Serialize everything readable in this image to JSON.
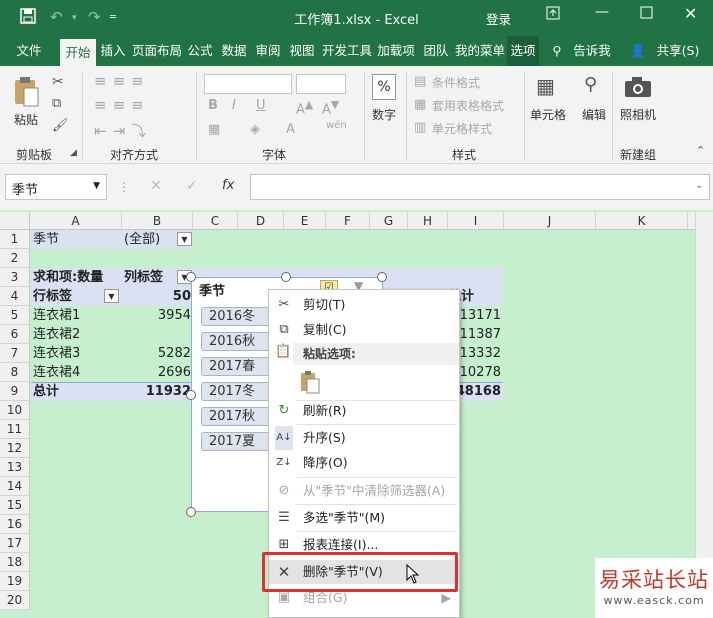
{
  "titlebar": {
    "title": "工作簿1.xlsx - Excel",
    "login": "登录"
  },
  "tabs": [
    "文件",
    "开始",
    "插入",
    "页面布局",
    "公式",
    "数据",
    "审阅",
    "视图",
    "开发工具",
    "加载项",
    "团队",
    "我的菜单",
    "选项"
  ],
  "tell_me": "告诉我",
  "share": "共享(S)",
  "ribbon": {
    "paste": "粘贴",
    "clipboard": "剪贴板",
    "alignment": "对齐方式",
    "font": "字体",
    "number": "数字",
    "number_icon": "%",
    "cond_format": "条件格式",
    "table_format": "套用表格格式",
    "cell_style": "单元格样式",
    "styles": "样式",
    "cells": "单元格",
    "editing": "编辑",
    "camera": "照相机",
    "new_group": "新建组",
    "bold": "B",
    "italic": "I",
    "underline": "U",
    "wen": "wén"
  },
  "formula": {
    "namebox": "季节",
    "fx": "fx"
  },
  "columns": [
    "A",
    "B",
    "C",
    "D",
    "E",
    "F",
    "G",
    "H",
    "I",
    "J",
    "K"
  ],
  "rows": [
    "1",
    "2",
    "3",
    "4",
    "5",
    "6",
    "7",
    "8",
    "9",
    "10",
    "11",
    "12",
    "13",
    "14",
    "15",
    "16",
    "17",
    "18",
    "19",
    "20"
  ],
  "pivot": {
    "a1": "季节",
    "b1": "(全部)",
    "a3": "求和项:数量",
    "b3": "列标签",
    "a4": "行标签",
    "b4": "50",
    "items": [
      {
        "label": "连衣裙1",
        "b": "3954",
        "i": "13171"
      },
      {
        "label": "连衣裙2",
        "b": "",
        "i": "11387"
      },
      {
        "label": "连衣裙3",
        "b": "5282",
        "i": "13332"
      },
      {
        "label": "连衣裙4",
        "b": "2696",
        "i": "10278"
      }
    ],
    "total_label": "总计",
    "total_b": "11932",
    "total_i": "48168",
    "i4": "总计"
  },
  "slicer": {
    "title": "季节",
    "items": [
      "2016冬",
      "2016秋",
      "2017春",
      "2017冬",
      "2017秋",
      "2017夏"
    ]
  },
  "menu": {
    "cut": "剪切(T)",
    "copy": "复制(C)",
    "paste_options": "粘贴选项:",
    "refresh": "刷新(R)",
    "sort_asc": "升序(S)",
    "sort_desc": "降序(O)",
    "clear_filter": "从\"季节\"中清除筛选器(A)",
    "multiselect": "多选\"季节\"(M)",
    "report_conn": "报表连接(I)...",
    "delete": "删除\"季节\"(V)",
    "group": "组合(G)"
  },
  "watermark": {
    "title": "易采站长站",
    "url": "www.easck.com"
  }
}
